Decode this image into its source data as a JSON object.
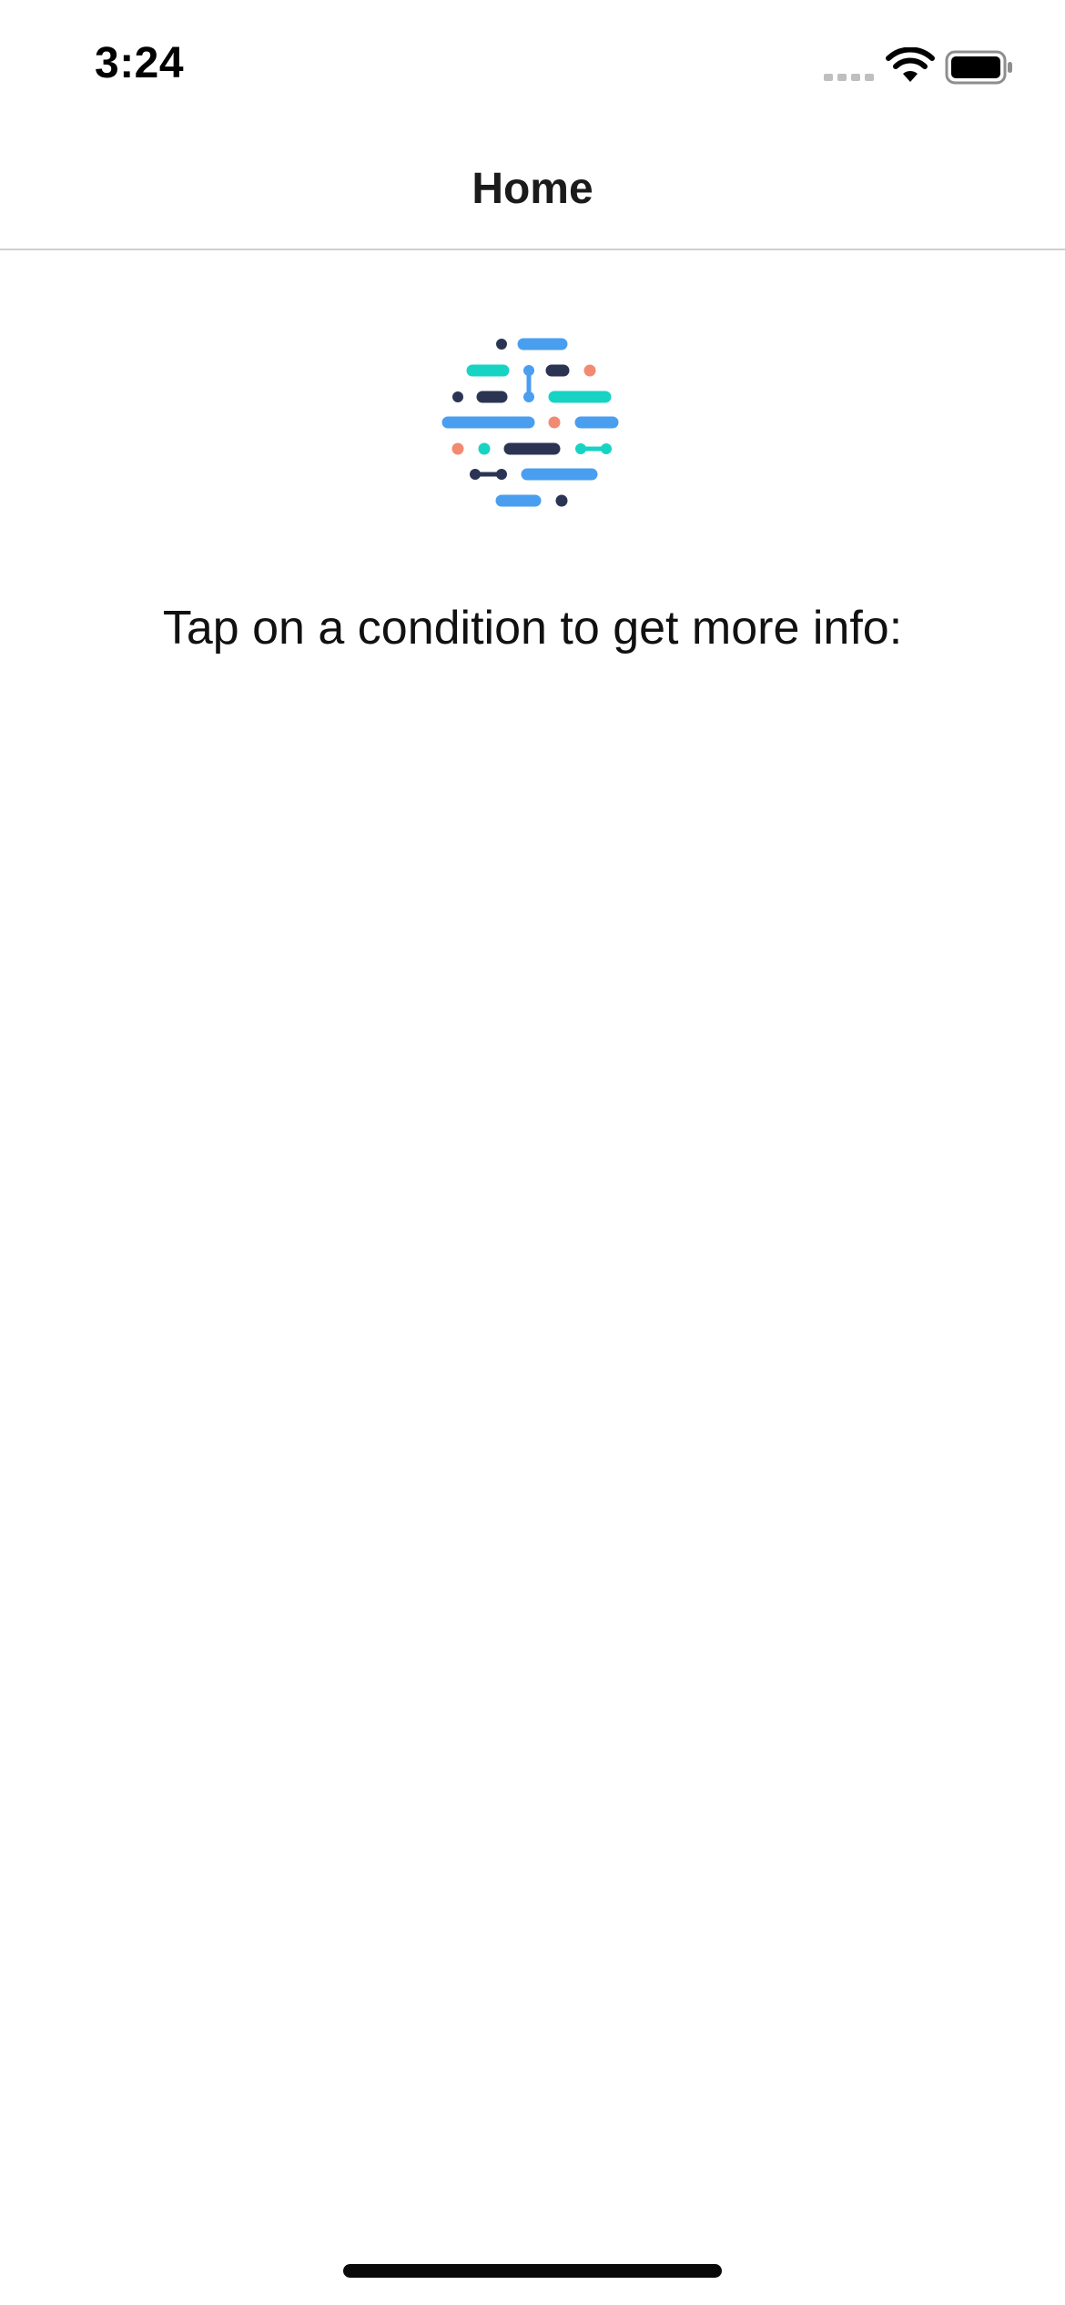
{
  "status_bar": {
    "time": "3:24",
    "icons": [
      "signal-icon",
      "wifi-icon",
      "battery-icon"
    ]
  },
  "nav": {
    "title": "Home"
  },
  "main": {
    "logo_icon": "dots-and-dashes-logo",
    "prompt": "Tap on a condition to get more info:"
  },
  "colors": {
    "navy": "#2b3553",
    "blue": "#4a9ef0",
    "teal": "#17d3c4",
    "coral": "#f28a72",
    "divider": "#cfcfcf"
  }
}
